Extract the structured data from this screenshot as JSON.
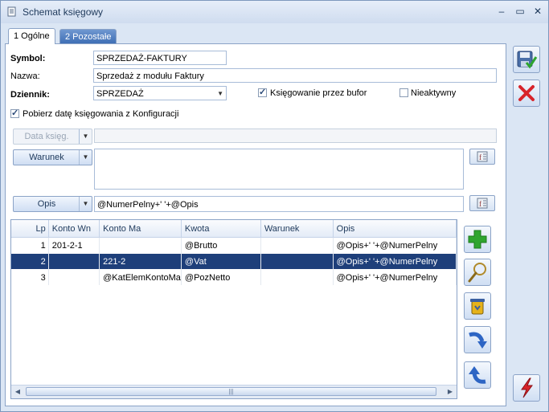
{
  "window": {
    "title": "Schemat księgowy",
    "controls": {
      "minimize": "‒",
      "maximize": "▭",
      "close": "✕"
    }
  },
  "tabs": [
    {
      "label": "1 Ogólne",
      "active": true
    },
    {
      "label": "2 Pozostałe",
      "active": false
    }
  ],
  "form": {
    "symbol_label": "Symbol:",
    "symbol_value": "SPRZEDAŻ-FAKTURY",
    "nazwa_label": "Nazwa:",
    "nazwa_value": "Sprzedaż z modułu Faktury",
    "dziennik_label": "Dziennik:",
    "dziennik_value": "SPRZEDAŻ",
    "bufor_label": "Księgowanie przez bufor",
    "bufor_checked": true,
    "nieaktywny_label": "Nieaktywny",
    "nieaktywny_checked": false,
    "pobierz_label": "Pobierz datę księgowania z Konfiguracji",
    "pobierz_checked": true
  },
  "expressions": {
    "data_ksieg_label": "Data księg.",
    "data_ksieg_value": "",
    "warunek_label": "Warunek",
    "warunek_value": "",
    "opis_label": "Opis",
    "opis_value": "@NumerPelny+' '+@Opis"
  },
  "grid": {
    "columns": [
      "Lp",
      "Konto Wn",
      "Konto Ma",
      "Kwota",
      "Warunek",
      "Opis"
    ],
    "rows": [
      {
        "lp": "1",
        "wn": "201-2-1",
        "ma": "",
        "kwota": "@Brutto",
        "warunek": "",
        "opis": "@Opis+' '+@NumerPelny",
        "selected": false
      },
      {
        "lp": "2",
        "wn": "",
        "ma": "221-2",
        "kwota": "@Vat",
        "warunek": "",
        "opis": "@Opis+' '+@NumerPelny",
        "selected": true
      },
      {
        "lp": "3",
        "wn": "",
        "ma": "@KatElemKontoMa",
        "kwota": "@PozNetto",
        "warunek": "",
        "opis": "@Opis+' '+@NumerPelny",
        "selected": false
      }
    ]
  },
  "icons": {
    "save": "save-icon",
    "cancel": "cancel-icon",
    "add": "add-icon",
    "edit": "magnifier-icon",
    "delete": "trash-icon",
    "down": "move-down-icon",
    "up": "move-up-icon",
    "run": "lightning-icon"
  },
  "colors": {
    "selection": "#1e3f7a",
    "add": "#2fa52f",
    "cancel": "#d8242a",
    "run": "#d8242a"
  }
}
